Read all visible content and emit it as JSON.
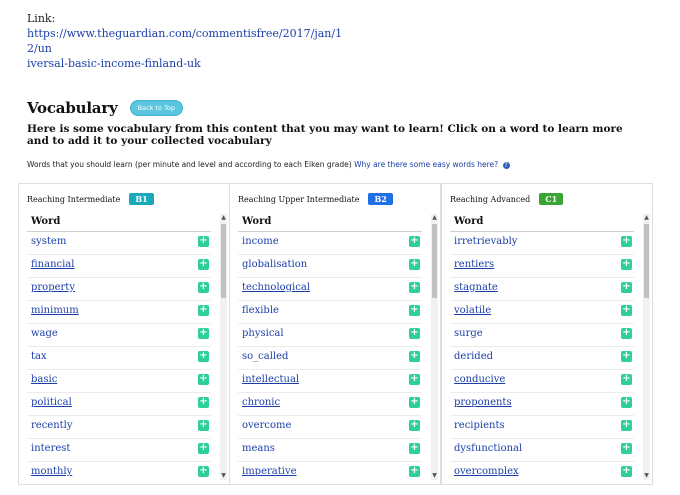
{
  "link": {
    "label": "Link:",
    "line1": "https://www.theguardian.com/commentisfree/2017/jan/12/un",
    "line2": "iversal-basic-income-finland-uk"
  },
  "vocab": {
    "title": "Vocabulary",
    "back_to_top": "Back to Top",
    "intro": "Here is some vocabulary from this content that you may want to learn! Click on a word to learn more and to add it to your collected vocabulary",
    "sub_text": "Words that you should learn (per minute and level and according to each Eiken grade)",
    "sub_link": "Why are there some easy words here?"
  },
  "columns": [
    {
      "title": "Reaching Intermediate",
      "level": "B1",
      "level_color": "#1aa9b8",
      "header": "Word",
      "words": [
        {
          "text": "system",
          "linked": false
        },
        {
          "text": "financial",
          "linked": true
        },
        {
          "text": "property",
          "linked": true
        },
        {
          "text": "minimum",
          "linked": true
        },
        {
          "text": "wage",
          "linked": false
        },
        {
          "text": "tax",
          "linked": false
        },
        {
          "text": "basic",
          "linked": true
        },
        {
          "text": "political",
          "linked": true
        },
        {
          "text": "recently",
          "linked": false
        },
        {
          "text": "interest",
          "linked": false
        },
        {
          "text": "monthly",
          "linked": true
        }
      ]
    },
    {
      "title": "Reaching Upper Intermediate",
      "level": "B2",
      "level_color": "#1f6fe5",
      "header": "Word",
      "words": [
        {
          "text": "income",
          "linked": false
        },
        {
          "text": "globalisation",
          "linked": false
        },
        {
          "text": "technological",
          "linked": true
        },
        {
          "text": "flexible",
          "linked": false
        },
        {
          "text": "physical",
          "linked": false
        },
        {
          "text": "so_called",
          "linked": false
        },
        {
          "text": "intellectual",
          "linked": true
        },
        {
          "text": "chronic",
          "linked": true
        },
        {
          "text": "overcome",
          "linked": false
        },
        {
          "text": "means",
          "linked": false
        },
        {
          "text": "imperative",
          "linked": true
        }
      ]
    },
    {
      "title": "Reaching Advanced",
      "level": "C1",
      "level_color": "#3aa534",
      "header": "Word",
      "words": [
        {
          "text": "irretrievably",
          "linked": false
        },
        {
          "text": "rentiers",
          "linked": true
        },
        {
          "text": "stagnate",
          "linked": true
        },
        {
          "text": "volatile",
          "linked": true
        },
        {
          "text": "surge",
          "linked": false
        },
        {
          "text": "derided",
          "linked": false
        },
        {
          "text": "conducive",
          "linked": true
        },
        {
          "text": "proponents",
          "linked": true
        },
        {
          "text": "recipients",
          "linked": false
        },
        {
          "text": "dysfunctional",
          "linked": false
        },
        {
          "text": "overcomplex",
          "linked": true
        }
      ]
    }
  ]
}
